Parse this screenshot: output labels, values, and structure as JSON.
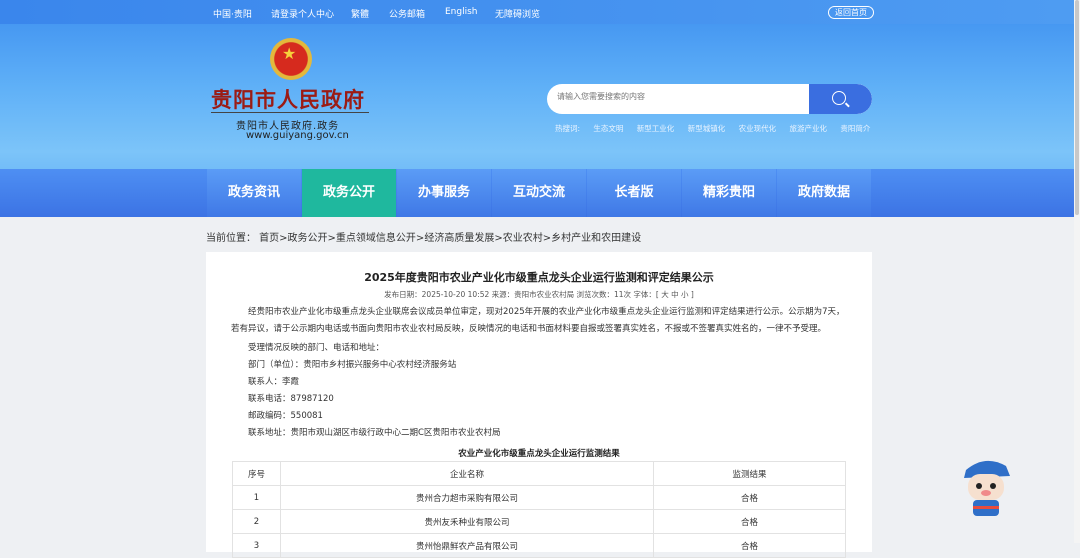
{
  "topbar": {
    "items": [
      "中国·贵阳",
      "请登录个人中心",
      "繁體",
      "公务邮箱",
      "English",
      "无障碍浏览"
    ],
    "back": "返回首页"
  },
  "logo": {
    "name": "贵阳市人民政府",
    "sub": "贵阳市人民政府.政务",
    "url": "www.guiyang.gov.cn"
  },
  "search": {
    "placeholder": "请输入您需要搜索的内容",
    "hot_label": "热搜词:",
    "hot": [
      "生态文明",
      "新型工业化",
      "新型城镇化",
      "农业现代化",
      "旅游产业化",
      "贵阳简介"
    ]
  },
  "nav": {
    "items": [
      "政务资讯",
      "政务公开",
      "办事服务",
      "互动交流",
      "长者版",
      "精彩贵阳",
      "政府数据"
    ],
    "active": 1,
    "active_color": "#1fb89e"
  },
  "breadcrumb": "当前位置： 首页>政务公开>重点领域信息公开>经济高质量发展>农业农村>乡村产业和农田建设",
  "article": {
    "title": "2025年度贵阳市农业产业化市级重点龙头企业运行监测和评定结果公示",
    "meta": "发布日期：2025-10-20 10:52 来源：贵阳市农业农村局 浏览次数：11次 字体：[ 大 中 小 ]",
    "paragraphs": [
      "经贵阳市农业产业化市级重点龙头企业联席会议成员单位审定，现对2025年开展的农业产业化市级重点龙头企业运行监测和评定结果进行公示。公示期为7天，若有异议，请于公示期内电话或书面向贵阳市农业农村局反映，反映情况的电话和书面材料要自报或签署真实姓名，不报或不签署真实姓名的，一律不予受理。",
      "受理情况反映的部门、电话和地址：",
      "部门（单位）：贵阳市乡村振兴服务中心农村经济服务站",
      "联系人：李霞",
      "联系电话：87987120",
      "邮政编码：550081",
      "联系地址：贵阳市观山湖区市级行政中心二期C区贵阳市农业农村局"
    ],
    "table_title": "农业产业化市级重点龙头企业运行监测结果",
    "headers": [
      "序号",
      "企业名称",
      "监测结果"
    ],
    "rows": [
      [
        "1",
        "贵州合力超市采购有限公司",
        "合格"
      ],
      [
        "2",
        "贵州友禾种业有限公司",
        "合格"
      ],
      [
        "3",
        "贵州怡鼎鲜农产品有限公司",
        "合格"
      ]
    ]
  }
}
